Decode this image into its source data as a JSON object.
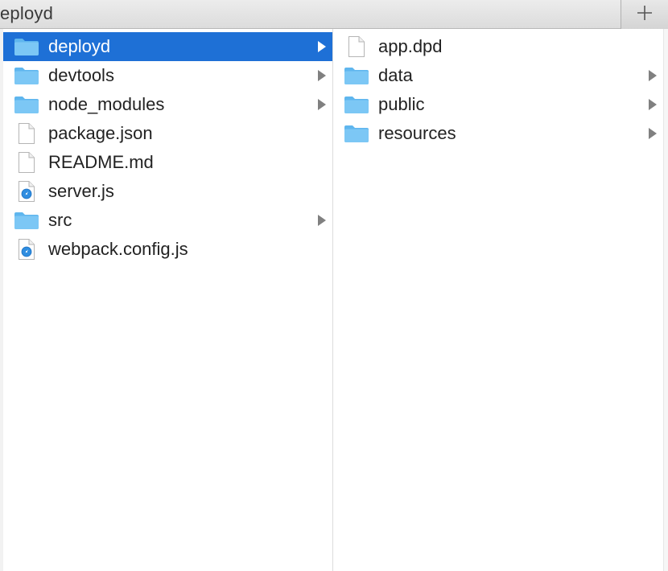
{
  "window": {
    "title": "eployd"
  },
  "toolbar": {
    "add_icon": "plus-icon"
  },
  "columns": [
    {
      "items": [
        {
          "name": "deployd",
          "kind": "folder",
          "has_children": true,
          "selected": true
        },
        {
          "name": "devtools",
          "kind": "folder",
          "has_children": true,
          "selected": false
        },
        {
          "name": "node_modules",
          "kind": "folder",
          "has_children": true,
          "selected": false
        },
        {
          "name": "package.json",
          "kind": "file",
          "has_children": false,
          "selected": false
        },
        {
          "name": "README.md",
          "kind": "file",
          "has_children": false,
          "selected": false
        },
        {
          "name": "server.js",
          "kind": "script",
          "has_children": false,
          "selected": false
        },
        {
          "name": "src",
          "kind": "folder",
          "has_children": true,
          "selected": false
        },
        {
          "name": "webpack.config.js",
          "kind": "script",
          "has_children": false,
          "selected": false
        }
      ]
    },
    {
      "items": [
        {
          "name": "app.dpd",
          "kind": "file",
          "has_children": false,
          "selected": false
        },
        {
          "name": "data",
          "kind": "folder",
          "has_children": true,
          "selected": false
        },
        {
          "name": "public",
          "kind": "folder",
          "has_children": true,
          "selected": false
        },
        {
          "name": "resources",
          "kind": "folder",
          "has_children": true,
          "selected": false
        }
      ]
    }
  ],
  "colors": {
    "selection": "#1e70d6",
    "folder": "#7cc7f5",
    "chevron": "#808080"
  }
}
